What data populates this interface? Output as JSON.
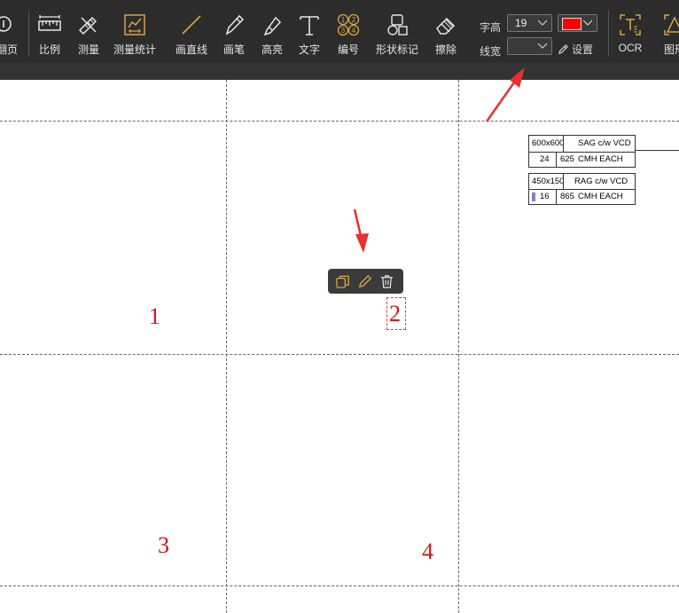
{
  "toolbar": {
    "tools": [
      {
        "label": "翻页",
        "icon": "page-turn-icon"
      },
      {
        "label": "比例",
        "icon": "ruler-icon"
      },
      {
        "label": "测量",
        "icon": "measure-icon"
      },
      {
        "label": "测量统计",
        "icon": "measure-stats-icon"
      },
      {
        "label": "画直线",
        "icon": "line-icon"
      },
      {
        "label": "画笔",
        "icon": "pen-icon"
      },
      {
        "label": "高亮",
        "icon": "highlighter-icon"
      },
      {
        "label": "文字",
        "icon": "text-icon"
      },
      {
        "label": "编号",
        "icon": "numbering-icon"
      },
      {
        "label": "形状标记",
        "icon": "shape-mark-icon"
      },
      {
        "label": "擦除",
        "icon": "eraser-icon"
      },
      {
        "label": "OCR",
        "icon": "ocr-icon"
      },
      {
        "label": "图形",
        "icon": "shape-icon"
      }
    ],
    "font_size_label": "字高",
    "font_size_value": "19",
    "line_width_label": "线宽",
    "line_width_value": "",
    "color_value": "#ff0000",
    "settings_label": "设置"
  },
  "canvas": {
    "numbers": [
      "1",
      "2",
      "3",
      "4"
    ],
    "float_actions": [
      {
        "name": "copy",
        "icon": "copy-icon"
      },
      {
        "name": "edit",
        "icon": "pencil-edit-icon"
      },
      {
        "name": "delete",
        "icon": "trash-icon"
      }
    ],
    "table1": {
      "r1c1": "600x600",
      "r1c2": "SAG c/w VCD",
      "r2c1": "24",
      "r2c2": "625",
      "r2c3": "CMH EACH"
    },
    "table2": {
      "r1c1": "450x150",
      "r1c2": "RAG c/w VCD",
      "r2c1": "16",
      "r2c2": "865",
      "r2c3": "CMH EACH"
    }
  },
  "colors": {
    "toolbar_bg": "#2c2c2c",
    "accent": "#d7a44a",
    "annotation_red": "#d21414",
    "arrow_red": "#e83030"
  }
}
